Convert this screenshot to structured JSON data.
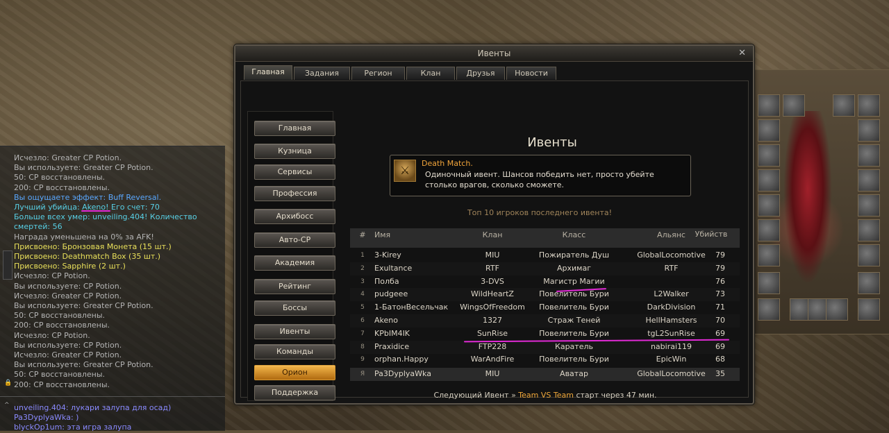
{
  "window": {
    "title": "Ивенты",
    "close_label": "✕"
  },
  "tabs": [
    {
      "label": "Главная",
      "active": true
    },
    {
      "label": "Задания",
      "active": false
    },
    {
      "label": "Регион",
      "active": false
    },
    {
      "label": "Клан",
      "active": false
    },
    {
      "label": "Друзья",
      "active": false
    },
    {
      "label": "Новости",
      "active": false
    }
  ],
  "menu": [
    {
      "label": "Главная",
      "active": false
    },
    {
      "label": "Кузница",
      "active": false
    },
    {
      "label": "Сервисы",
      "active": false
    },
    {
      "label": "Профессия",
      "active": false
    },
    {
      "label": "Архибосс",
      "active": false
    },
    {
      "label": "Авто-CP",
      "active": false
    },
    {
      "label": "Академия",
      "active": false
    },
    {
      "label": "Рейтинг",
      "active": false
    },
    {
      "label": "Боссы",
      "active": false
    },
    {
      "label": "Ивенты",
      "active": false
    },
    {
      "label": "Команды",
      "active": false
    },
    {
      "label": "Орион",
      "active": true
    },
    {
      "label": "Поддержка",
      "active": false
    }
  ],
  "content": {
    "heading": "Ивенты",
    "event_title": "Death Match.",
    "event_desc": "Одиночный ивент. Шансов победить нет, просто убейте столько врагов, сколько сможете.",
    "top_caption": "Топ 10 игроков последнего ивента!",
    "columns": [
      "#",
      "Имя",
      "Клан",
      "Класс",
      "Альянс",
      "Убийств"
    ],
    "rows": [
      {
        "n": "1",
        "name": "3-Kirey",
        "clan": "MIU",
        "cls": "Пожиратель Душ",
        "ally": "GlobalLocomotive",
        "kills": "79"
      },
      {
        "n": "2",
        "name": "Exultance",
        "clan": "RTF",
        "cls": "Архимаг",
        "ally": "RTF",
        "kills": "79"
      },
      {
        "n": "3",
        "name": "Полба",
        "clan": "3-DVS",
        "cls": "Магистр Магии",
        "ally": "",
        "kills": "76"
      },
      {
        "n": "4",
        "name": "pudgeee",
        "clan": "WildHeartZ",
        "cls": "Повелитель Бури",
        "ally": "L2Walker",
        "kills": "73"
      },
      {
        "n": "5",
        "name": "1-БатонВесельчак",
        "clan": "WingsOfFreedom",
        "cls": "Повелитель Бури",
        "ally": "DarkDivision",
        "kills": "71"
      },
      {
        "n": "6",
        "name": "Akeno",
        "clan": "1327",
        "cls": "Страж Теней",
        "ally": "HellHamsters",
        "kills": "70"
      },
      {
        "n": "7",
        "name": "KPbIM4IK",
        "clan": "SunRise",
        "cls": "Повелитель Бури",
        "ally": "tgL2SunRise",
        "kills": "69"
      },
      {
        "n": "8",
        "name": "Praxidice",
        "clan": "FTP228",
        "cls": "Каратель",
        "ally": "nabirai119",
        "kills": "69"
      },
      {
        "n": "9",
        "name": "orphan.Happy",
        "clan": "WarAndFire",
        "cls": "Повелитель Бури",
        "ally": "EpicWin",
        "kills": "68"
      }
    ],
    "self_row": {
      "n": "Я",
      "name": "Pa3DyplyaWka",
      "clan": "MIU",
      "cls": "Аватар",
      "ally": "GlobalLocomotive",
      "kills": "35"
    },
    "next_label": "Следующий Ивент",
    "next_arrow": "»",
    "next_event": "Team VS Team",
    "next_time": "старт через 47 мин."
  },
  "chat": {
    "lines": [
      {
        "text": "Исчезло: Greater CP Potion.",
        "color": "grey"
      },
      {
        "text": "Вы используете: Greater CP Potion.",
        "color": "grey"
      },
      {
        "text": "50: CP восстановлены.",
        "color": "grey"
      },
      {
        "text": "200: CP восстановлены.",
        "color": "grey"
      },
      {
        "text": "Вы ощущаете эффект: Buff Reversal.",
        "color": "blue"
      },
      {
        "text": "Лучший убийца: Akeno! Его счет: 70",
        "color": "cyan"
      },
      {
        "text": "Больше всех умер: unveiling.404! Количество",
        "color": "cyan"
      },
      {
        "text": " смертей: 56",
        "color": "cyan"
      },
      {
        "text": "Награда уменьшена на 0% за AFK!",
        "color": "grey"
      },
      {
        "text": "Присвоено: Бронзовая Монета (15 шт.)",
        "color": "yellow"
      },
      {
        "text": "Присвоено: Deathmatch Box (35 шт.)",
        "color": "yellow"
      },
      {
        "text": "Присвоено: Sapphire (2 шт.)",
        "color": "yellow"
      },
      {
        "text": "Исчезло: CP Potion.",
        "color": "grey"
      },
      {
        "text": "Вы используете: CP Potion.",
        "color": "grey"
      },
      {
        "text": "Исчезло: Greater CP Potion.",
        "color": "grey"
      },
      {
        "text": "Вы используете: Greater CP Potion.",
        "color": "grey"
      },
      {
        "text": "50: CP восстановлены.",
        "color": "grey"
      },
      {
        "text": "200: CP восстановлены.",
        "color": "grey"
      },
      {
        "text": "Исчезло: CP Potion.",
        "color": "grey"
      },
      {
        "text": "Вы используете: CP Potion.",
        "color": "grey"
      },
      {
        "text": "Исчезло: Greater CP Potion.",
        "color": "grey"
      },
      {
        "text": "Вы используете: Greater CP Potion.",
        "color": "grey"
      },
      {
        "text": "50: CP восстановлены.",
        "color": "grey"
      },
      {
        "text": "200: CP восстановлены.",
        "color": "grey"
      }
    ],
    "party_lines": [
      {
        "text": "unveiling.404: лукари залупа для осад)"
      },
      {
        "text": "Pa3DyplyaWka: )"
      },
      {
        "text": "blyckOp1um: эта игра залупа"
      }
    ]
  },
  "colors": {
    "grey": "#b4b4b4",
    "blue": "#5aa8ff",
    "cyan": "#58d0e6",
    "yellow": "#e9e05a",
    "accent": "#f0a83a",
    "highlight": "#e22ad6"
  }
}
